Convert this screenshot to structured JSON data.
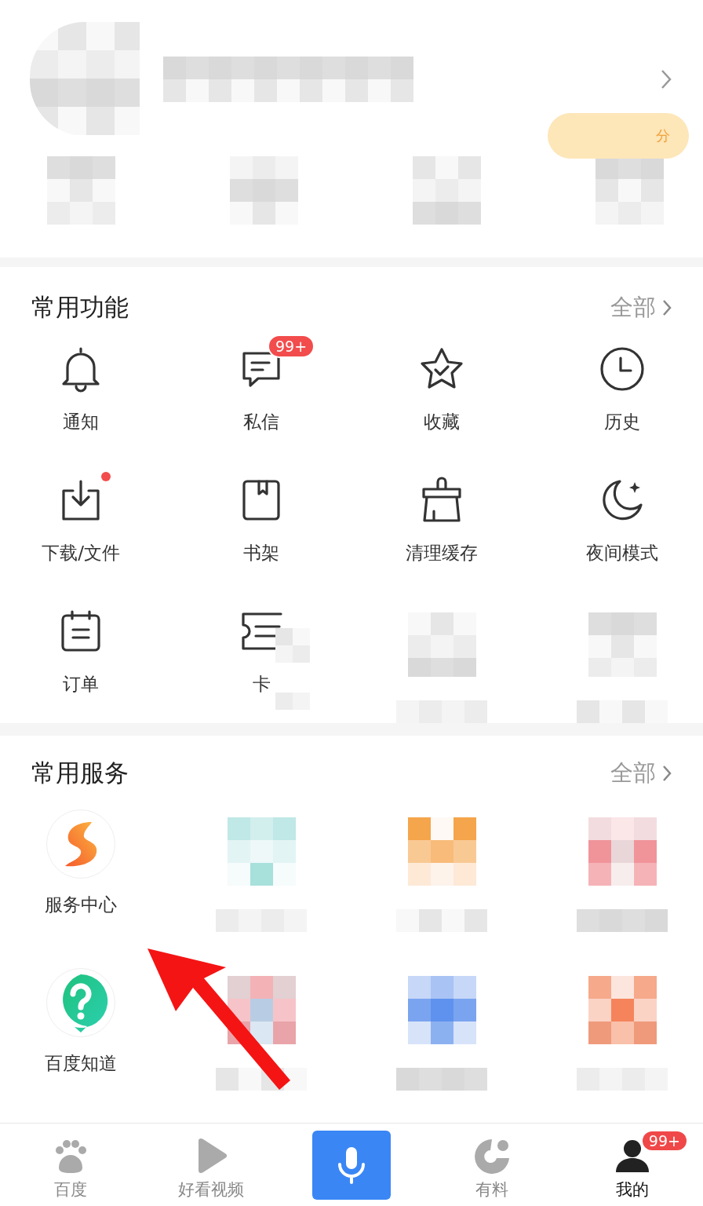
{
  "profile": {
    "points_badge": "分"
  },
  "sections": [
    {
      "title": "常用功能",
      "more": "全部",
      "items": [
        {
          "kind": "icon",
          "label": "通知"
        },
        {
          "kind": "icon",
          "label": "私信",
          "badge": "99+"
        },
        {
          "kind": "icon",
          "label": "收藏"
        },
        {
          "kind": "icon",
          "label": "历史"
        },
        {
          "kind": "icon",
          "label": "下载/文件",
          "dot": true
        },
        {
          "kind": "icon",
          "label": "书架"
        },
        {
          "kind": "icon",
          "label": "清理缓存"
        },
        {
          "kind": "icon",
          "label": "夜间模式"
        },
        {
          "kind": "icon",
          "label": "订单"
        },
        {
          "kind": "partial",
          "label": "卡"
        },
        {
          "kind": "blurred"
        },
        {
          "kind": "blurred"
        }
      ]
    },
    {
      "title": "常用服务",
      "more": "全部",
      "items": [
        {
          "kind": "logo",
          "label": "服务中心"
        },
        {
          "kind": "blurred"
        },
        {
          "kind": "blurred"
        },
        {
          "kind": "blurred"
        },
        {
          "kind": "logo",
          "label": "百度知道"
        },
        {
          "kind": "blurred"
        },
        {
          "kind": "blurred"
        },
        {
          "kind": "blurred"
        }
      ]
    }
  ],
  "tabbar": [
    {
      "kind": "tab",
      "label": "百度",
      "selected": false
    },
    {
      "kind": "tab",
      "label": "好看视频",
      "selected": false
    },
    {
      "kind": "mic"
    },
    {
      "kind": "tab",
      "label": "有料",
      "selected": false
    },
    {
      "kind": "tab",
      "label": "我的",
      "selected": true,
      "badge": "99+"
    }
  ]
}
